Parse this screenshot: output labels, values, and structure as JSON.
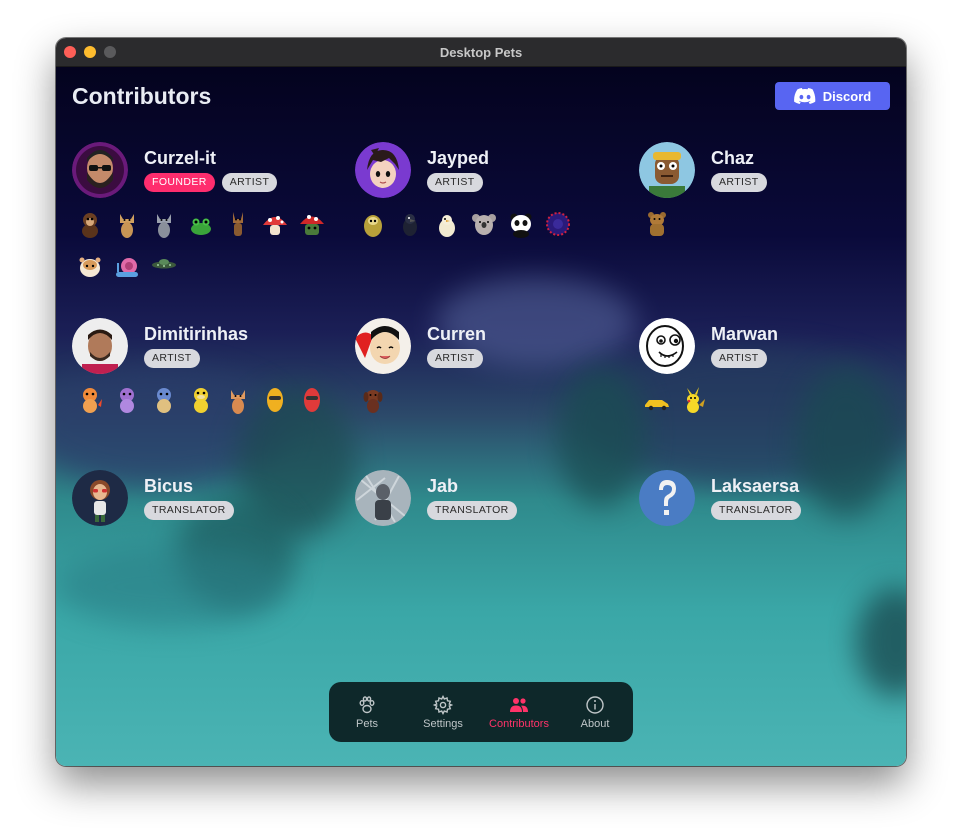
{
  "window": {
    "title": "Desktop Pets"
  },
  "header": {
    "title": "Contributors",
    "discord_label": "Discord"
  },
  "contributors": [
    {
      "name": "Curzel-it",
      "badges": [
        "FOUNDER",
        "ARTIST"
      ],
      "avatar_icon": "bearded-man-avatar-icon",
      "pets": [
        "monkey",
        "cat-tan",
        "cat-gray",
        "frog",
        "dog",
        "mushroom-red",
        "mushroom-green",
        "hamster",
        "snail",
        "ufo"
      ]
    },
    {
      "name": "Jayped",
      "badges": [
        "ARTIST"
      ],
      "avatar_icon": "anime-girl-avatar-icon",
      "pets": [
        "sloth",
        "crow",
        "chick",
        "koala",
        "panda",
        "hedgehog"
      ]
    },
    {
      "name": "Chaz",
      "badges": [
        "ARTIST"
      ],
      "avatar_icon": "cartoon-man-avatar-icon",
      "pets": [
        "bear"
      ]
    },
    {
      "name": "Dimitirinhas",
      "badges": [
        "ARTIST"
      ],
      "avatar_icon": "man-photo-avatar-icon",
      "pets": [
        "charmander",
        "rattata",
        "squirtle",
        "psyduck",
        "cat-orange",
        "egg-yellow",
        "egg-red"
      ]
    },
    {
      "name": "Curren",
      "badges": [
        "ARTIST"
      ],
      "avatar_icon": "anime-character-avatar-icon",
      "pets": [
        "brown-dog"
      ]
    },
    {
      "name": "Marwan",
      "badges": [
        "ARTIST"
      ],
      "avatar_icon": "cartoon-face-avatar-icon",
      "pets": [
        "yellow-car",
        "pikachu"
      ]
    },
    {
      "name": "Bicus",
      "badges": [
        "TRANSLATOR"
      ],
      "avatar_icon": "bitmoji-avatar-icon",
      "pets": []
    },
    {
      "name": "Jab",
      "badges": [
        "TRANSLATOR"
      ],
      "avatar_icon": "photo-avatar-icon",
      "pets": []
    },
    {
      "name": "Laksaersa",
      "badges": [
        "TRANSLATOR"
      ],
      "avatar_icon": "question-mark-avatar-icon",
      "pets": []
    }
  ],
  "tabs": [
    {
      "label": "Pets",
      "icon": "paw-icon",
      "active": false
    },
    {
      "label": "Settings",
      "icon": "gear-icon",
      "active": false
    },
    {
      "label": "Contributors",
      "icon": "people-icon",
      "active": true
    },
    {
      "label": "About",
      "icon": "info-icon",
      "active": false
    }
  ],
  "colors": {
    "accent": "#ff3369",
    "founder": "#ff2d6e",
    "discord": "#5865f2"
  }
}
